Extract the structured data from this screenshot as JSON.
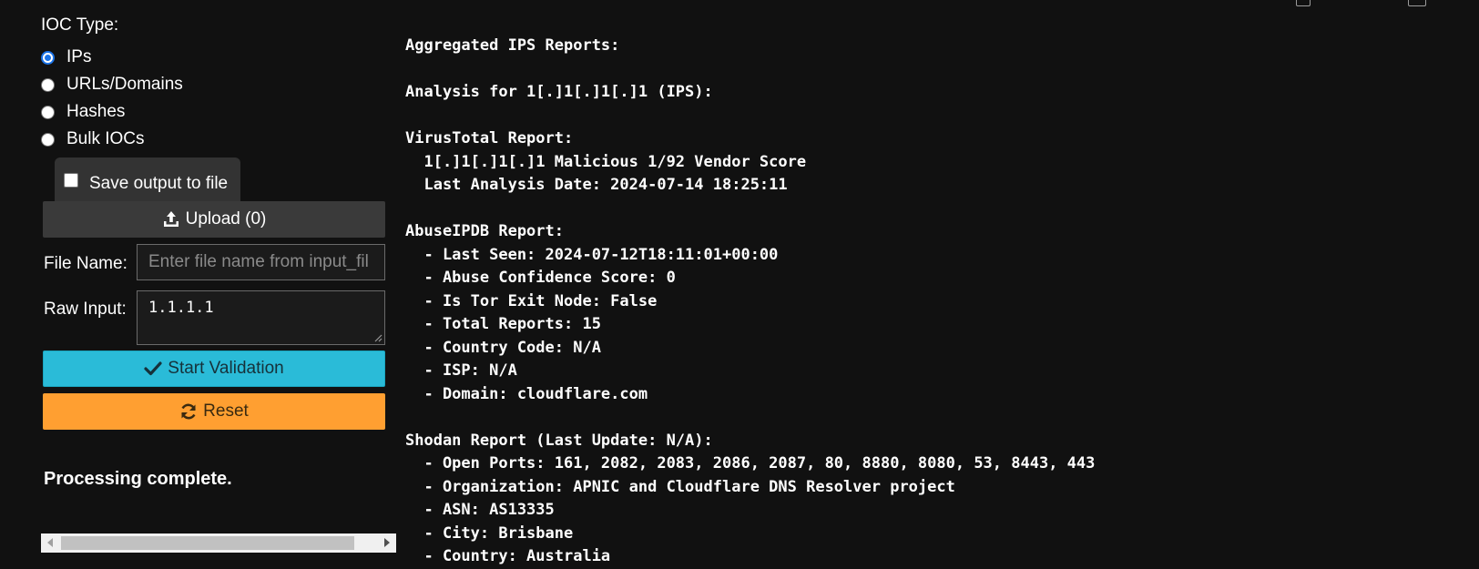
{
  "ioc": {
    "label": "IOC Type:",
    "options": [
      {
        "label": "IPs",
        "checked": true
      },
      {
        "label": "URLs/Domains",
        "checked": false
      },
      {
        "label": "Hashes",
        "checked": false
      },
      {
        "label": "Bulk IOCs",
        "checked": false
      }
    ]
  },
  "save_output": {
    "label": "Save output to file",
    "checked": false
  },
  "upload": {
    "label": "Upload (0)",
    "icon": "upload-icon"
  },
  "file_name": {
    "label": "File Name:",
    "placeholder": "Enter file name from input_fil",
    "value": ""
  },
  "raw_input": {
    "label": "Raw Input:",
    "value": "1.1.1.1"
  },
  "buttons": {
    "start": {
      "label": "Start Validation",
      "icon": "check-icon",
      "color": "#2abbd8"
    },
    "reset": {
      "label": "Reset",
      "icon": "refresh-icon",
      "color": "#ff9f31"
    }
  },
  "status": "Processing complete.",
  "output_lines": [
    "Aggregated IPS Reports:",
    "",
    "Analysis for 1[.]1[.]1[.]1 (IPS):",
    "",
    "VirusTotal Report:",
    "  1[.]1[.]1[.]1 Malicious 1/92 Vendor Score",
    "  Last Analysis Date: 2024-07-14 18:25:11",
    "",
    "AbuseIPDB Report:",
    "  - Last Seen: 2024-07-12T18:11:01+00:00",
    "  - Abuse Confidence Score: 0",
    "  - Is Tor Exit Node: False",
    "  - Total Reports: 15",
    "  - Country Code: N/A",
    "  - ISP: N/A",
    "  - Domain: cloudflare.com",
    "",
    "Shodan Report (Last Update: N/A):",
    "  - Open Ports: 161, 2082, 2083, 2086, 2087, 80, 8880, 8080, 53, 8443, 443",
    "  - Organization: APNIC and Cloudflare DNS Resolver project",
    "  - ASN: AS13335",
    "  - City: Brisbane",
    "  - Country: Australia"
  ],
  "colors": {
    "background": "#111111",
    "panel": "#333333",
    "text": "#ffffff"
  }
}
